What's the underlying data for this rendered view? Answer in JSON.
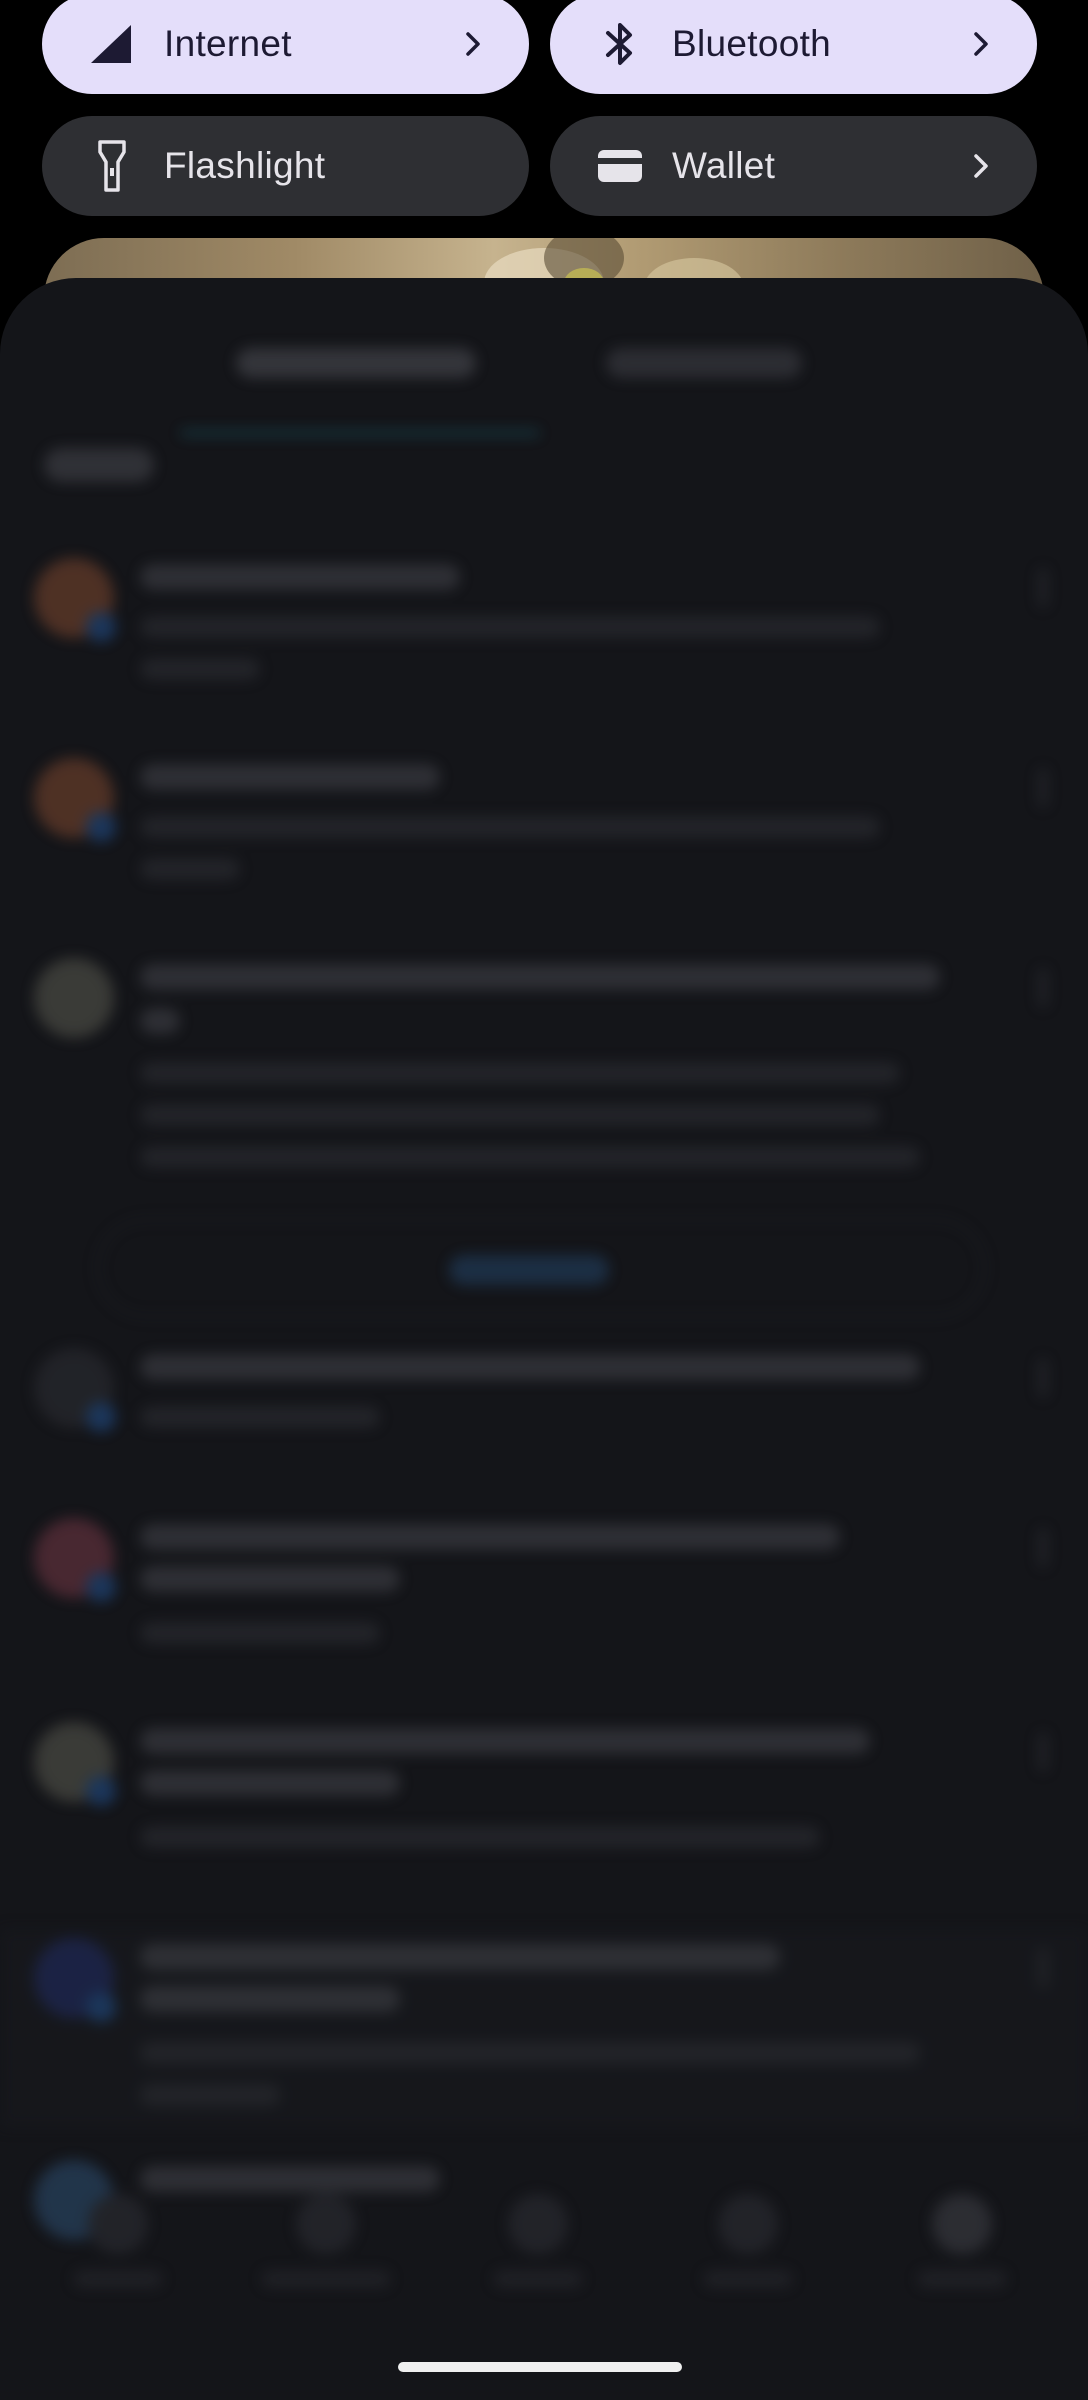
{
  "quick_settings": {
    "tiles": [
      {
        "label": "Internet",
        "icon": "signal-icon",
        "state": "on",
        "chevron": true
      },
      {
        "label": "Bluetooth",
        "icon": "bluetooth-icon",
        "state": "on",
        "chevron": true
      },
      {
        "label": "Flashlight",
        "icon": "flashlight-icon",
        "state": "off",
        "chevron": false
      },
      {
        "label": "Wallet",
        "icon": "wallet-icon",
        "state": "off",
        "chevron": true
      }
    ]
  },
  "colors": {
    "tile_on": "#e4defa",
    "tile_off": "#2e2f33",
    "shade": "#141519"
  }
}
